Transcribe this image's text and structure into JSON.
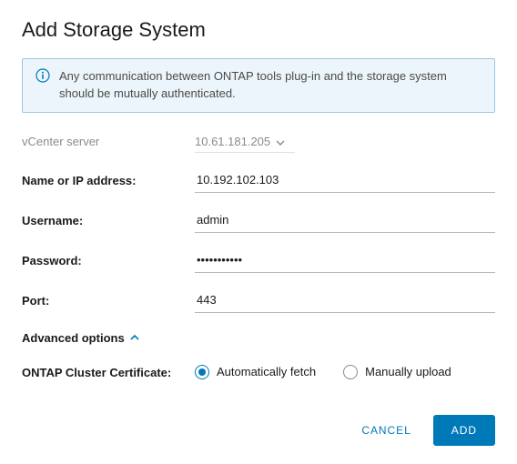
{
  "title": "Add Storage System",
  "info": {
    "text": "Any communication between ONTAP tools plug-in and the storage system should be mutually authenticated."
  },
  "form": {
    "vcenter_label": "vCenter server",
    "vcenter_value": "10.61.181.205",
    "name_label": "Name or IP address:",
    "name_value": "10.192.102.103",
    "username_label": "Username:",
    "username_value": "admin",
    "password_label": "Password:",
    "password_value": "•••••••••••",
    "port_label": "Port:",
    "port_value": "443"
  },
  "advanced": {
    "toggle_label": "Advanced options",
    "cert_label": "ONTAP Cluster Certificate:",
    "radio_auto": "Automatically fetch",
    "radio_manual": "Manually upload",
    "selected": "auto"
  },
  "buttons": {
    "cancel": "Cancel",
    "add": "Add"
  }
}
